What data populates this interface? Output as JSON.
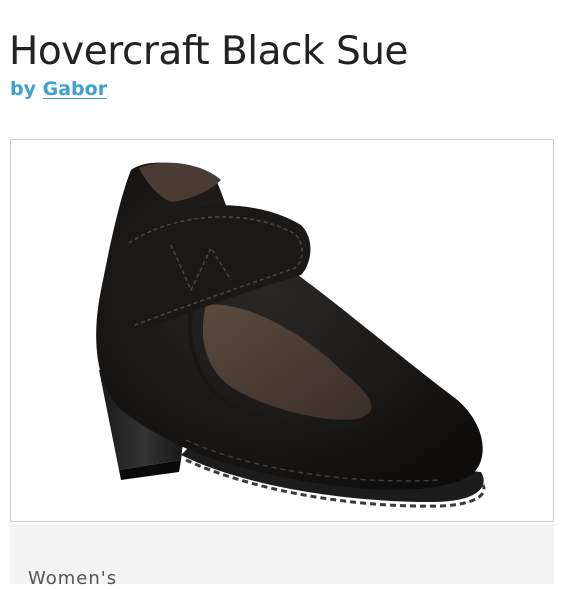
{
  "product": {
    "title": "Hovercraft Black Sue",
    "by_prefix": "by",
    "brand": "Gabor",
    "image_alt": "shoe-image"
  },
  "details": {
    "category": "Women's"
  },
  "colors": {
    "title": "#222222",
    "brand_link": "#3f9fd0",
    "frame_border": "#cfcfcf",
    "panel_bg": "#f4f4f4"
  }
}
